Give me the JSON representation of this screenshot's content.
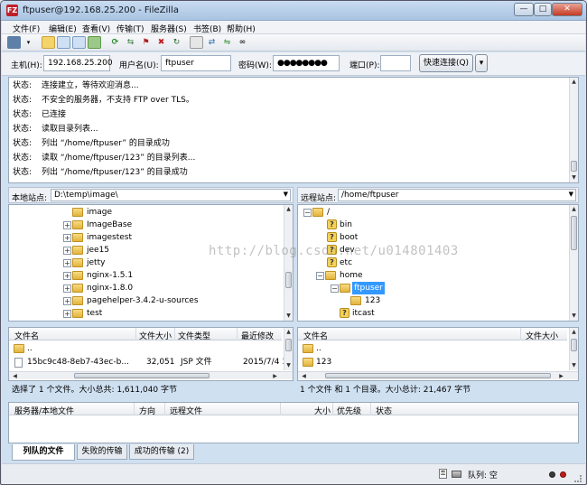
{
  "window": {
    "title": "ftpuser@192.168.25.200 - FileZilla",
    "icon_text": "FZ",
    "minimize_glyph": "—",
    "maximize_glyph": "□",
    "close_glyph": "✕"
  },
  "menu": [
    "文件(F)",
    "编辑(E)",
    "查看(V)",
    "传输(T)",
    "服务器(S)",
    "书签(B)",
    "帮助(H)"
  ],
  "quickconnect": {
    "host_label": "主机(H):",
    "host_value": "192.168.25.200",
    "user_label": "用户名(U):",
    "user_value": "ftpuser",
    "pass_label": "密码(W):",
    "pass_value": "●●●●●●●●",
    "port_label": "端口(P):",
    "port_value": "",
    "connect_label": "快速连接(Q)",
    "dropdown_glyph": "▾"
  },
  "log": [
    {
      "label": "状态:",
      "message": "连接建立，等待欢迎消息..."
    },
    {
      "label": "状态:",
      "message": "不安全的服务器，不支持 FTP over TLS。"
    },
    {
      "label": "状态:",
      "message": "已连接"
    },
    {
      "label": "状态:",
      "message": "读取目录列表..."
    },
    {
      "label": "状态:",
      "message": "列出 “/home/ftpuser” 的目录成功"
    },
    {
      "label": "状态:",
      "message": "读取 “/home/ftpuser/123” 的目录列表..."
    },
    {
      "label": "状态:",
      "message": "列出 “/home/ftpuser/123” 的目录成功"
    }
  ],
  "local": {
    "site_label": "本地站点:",
    "site_path": "D:\\temp\\image\\",
    "tree": [
      "image",
      "ImageBase",
      "imagestest",
      "jee15",
      "jetty",
      "nginx-1.5.1",
      "nginx-1.8.0",
      "pagehelper-3.4.2-u-sources",
      "test"
    ],
    "columns": [
      "文件名",
      "文件大小",
      "文件类型",
      "最近修改"
    ],
    "rows": [
      {
        "name": "..",
        "size": "",
        "type": "",
        "modified": ""
      },
      {
        "name": "15bc9c48-8eb7-43ec-b...",
        "size": "32,051",
        "type": "JSP 文件",
        "modified": "2015/7/4 1"
      }
    ],
    "status": "选择了 1 个文件。大小总共: 1,611,040 字节"
  },
  "remote": {
    "site_label": "远程站点:",
    "site_path": "/home/ftpuser",
    "tree": [
      "/",
      "bin",
      "boot",
      "dev",
      "etc",
      "home",
      "ftpuser",
      "123",
      "itcast"
    ],
    "columns": [
      "文件名",
      "文件大小"
    ],
    "rows": [
      {
        "name": "..",
        "size": ""
      },
      {
        "name": "123",
        "size": ""
      }
    ],
    "status": "1 个文件 和 1 个目录。大小总计: 21,467 字节"
  },
  "queue": {
    "columns": [
      "服务器/本地文件",
      "方向",
      "远程文件",
      "大小",
      "优先级",
      "状态"
    ]
  },
  "tabs": [
    "列队的文件",
    "失败的传输",
    "成功的传输 (2)"
  ],
  "statusbar": {
    "queue_label": "队列: 空"
  },
  "watermark": "http://blog.csdn.net/u014801403",
  "colors": {
    "selection": "#3399ff",
    "title_bar": "#b9d1ea"
  }
}
